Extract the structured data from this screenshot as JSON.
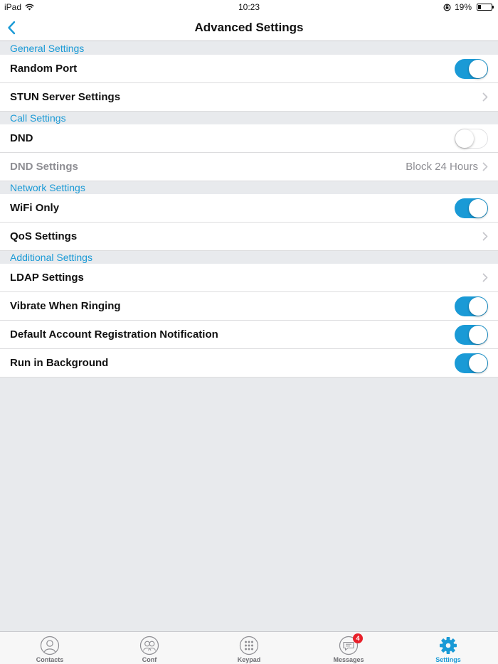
{
  "status": {
    "device": "iPad",
    "time": "10:23",
    "battery": "19%",
    "battery_level": 0.19
  },
  "nav": {
    "title": "Advanced Settings",
    "back_icon": "chevron-left-icon"
  },
  "sections": [
    {
      "header": "General Settings",
      "rows": [
        {
          "label": "Random Port",
          "control": "toggle",
          "on": true
        },
        {
          "label": "STUN Server Settings",
          "control": "chevron"
        }
      ]
    },
    {
      "header": "Call Settings",
      "rows": [
        {
          "label": "DND",
          "control": "toggle",
          "on": false
        },
        {
          "label": "DND Settings",
          "control": "chevron",
          "value": "Block 24 Hours",
          "disabled": true
        }
      ]
    },
    {
      "header": "Network Settings",
      "rows": [
        {
          "label": "WiFi Only",
          "control": "toggle",
          "on": true
        },
        {
          "label": "QoS Settings",
          "control": "chevron"
        }
      ]
    },
    {
      "header": "Additional Settings",
      "rows": [
        {
          "label": "LDAP Settings",
          "control": "chevron"
        },
        {
          "label": "Vibrate When Ringing",
          "control": "toggle",
          "on": true
        },
        {
          "label": "Default Account Registration Notification",
          "control": "toggle",
          "on": true
        },
        {
          "label": "Run in Background",
          "control": "toggle",
          "on": true
        }
      ]
    }
  ],
  "tabs": [
    {
      "label": "Contacts",
      "icon": "person-icon",
      "active": false
    },
    {
      "label": "Conf",
      "icon": "group-icon",
      "active": false
    },
    {
      "label": "Keypad",
      "icon": "keypad-icon",
      "active": false
    },
    {
      "label": "Messages",
      "icon": "chat-bubble-icon",
      "active": false,
      "badge": "4"
    },
    {
      "label": "Settings",
      "icon": "gear-icon",
      "active": true
    }
  ],
  "colors": {
    "accent": "#1a9ad6",
    "background": "#e8eaed",
    "badge": "#e8202a"
  }
}
